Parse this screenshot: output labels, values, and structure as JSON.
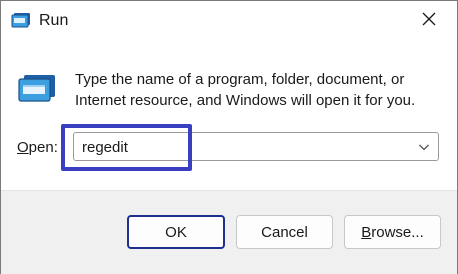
{
  "window": {
    "title": "Run",
    "description": "Type the name of a program, folder, document, or Internet resource, and Windows will open it for you."
  },
  "open_field": {
    "label_accel": "O",
    "label_rest": "pen:",
    "value": "regedit"
  },
  "buttons": {
    "ok": "OK",
    "cancel": "Cancel",
    "browse_accel": "B",
    "browse_rest": "rowse..."
  },
  "colors": {
    "highlight": "#3a3fbf",
    "icon_accent": "#3b9fe0",
    "footer_bg": "#f0f0f0"
  },
  "icons": [
    "run-app-icon",
    "close-icon",
    "run-large-icon",
    "chevron-down-icon"
  ]
}
